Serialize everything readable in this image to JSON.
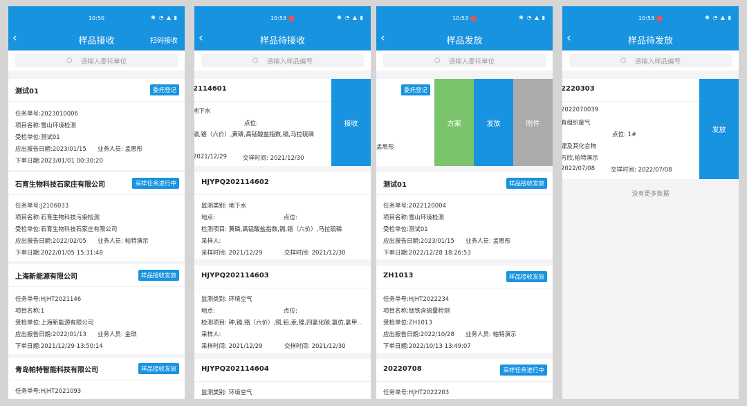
{
  "colors": {
    "primary": "#1793e0",
    "green": "#7cc46c",
    "gray": "#ababab",
    "background": "#d5d5d5"
  },
  "phones": [
    {
      "time": "10:50",
      "title": "样品接收",
      "right": "扫码接收",
      "search_placeholder": "请输入委托单位",
      "cards": [
        {
          "title": "测试01",
          "badge": "委托登记",
          "rows": [
            {
              "label": "任务单号:",
              "value": "2023010006"
            },
            {
              "label": "项目名称:",
              "value": "雪山环境检测"
            },
            {
              "label": "受检单位:",
              "value": "测试01"
            },
            {
              "label": "应出报告日期:",
              "value": "2023/01/15",
              "label2": "业务人员:",
              "value2": "孟思彤"
            },
            {
              "label": "下单日期:",
              "value": "2023/01/01 00:30:20"
            }
          ]
        },
        {
          "title": "石育生物科技石家庄有限公司",
          "badge": "采样任务进行中",
          "rows": [
            {
              "label": "任务单号:",
              "value": "J2106033"
            },
            {
              "label": "项目名称:",
              "value": "石育生物科技污染检测"
            },
            {
              "label": "受检单位:",
              "value": "石育生物科技石家庄有限公司"
            },
            {
              "label": "应出报告日期:",
              "value": "2022/02/05",
              "label2": "业务人员:",
              "value2": "帕特演示"
            },
            {
              "label": "下单日期:",
              "value": "2022/01/05 15:31:48"
            }
          ]
        },
        {
          "title": "上海新能源有限公司",
          "badge": "样品接收发放",
          "rows": [
            {
              "label": "任务单号:",
              "value": "HJHT2021146"
            },
            {
              "label": "项目名称:",
              "value": "1"
            },
            {
              "label": "受检单位:",
              "value": "上海新能源有限公司"
            },
            {
              "label": "应出报告日期:",
              "value": "2022/01/13",
              "label2": "业务人员:",
              "value2": "金琪"
            },
            {
              "label": "下单日期:",
              "value": "2021/12/29 13:50:14"
            }
          ]
        },
        {
          "title": "青岛帕特智能科技有限公司",
          "badge": "样品接收发放",
          "rows": [
            {
              "label": "任务单号:",
              "value": "HJHT2021093"
            }
          ]
        }
      ]
    },
    {
      "time": "10:53",
      "title": "样品待接收",
      "search_placeholder": "请输入样品编号",
      "swiped": {
        "title": "2114601",
        "action": "接收",
        "rows": [
          {
            "text": "地下水"
          },
          {
            "text": "点位:"
          },
          {
            "text": "镉,铬（六价）,黄磷,高锰酸盐指数,镉,马拉硫磷"
          },
          {
            "text": ""
          },
          {
            "text": "2021/12/29",
            "text2": "交样时间:",
            "value2": "2021/12/30"
          }
        ]
      },
      "cards": [
        {
          "title": "HJYPQ202114602",
          "rows": [
            {
              "label": "监测类别:",
              "value": "地下水"
            },
            {
              "label": "地点:",
              "value": "",
              "label2": "点位:",
              "value2": ""
            },
            {
              "label": "检测项目:",
              "value": "黄磷,高锰酸盐指数,镉,铬（六价）,马拉硫磷"
            },
            {
              "label": "采样人:",
              "value": ""
            },
            {
              "label": "采样时间:",
              "value": "2021/12/29",
              "label2": "交样时间:",
              "value2": "2021/12/30"
            }
          ]
        },
        {
          "title": "HJYPQ202114603",
          "rows": [
            {
              "label": "监测类别:",
              "value": "环境空气"
            },
            {
              "label": "地点:",
              "value": "",
              "label2": "点位:",
              "value2": ""
            },
            {
              "label": "检测项目:",
              "value": "砷,镉,铬（六价）,铜,铅,汞,镍,四氯化碳,氯仿,氯甲..."
            },
            {
              "label": "采样人:",
              "value": ""
            },
            {
              "label": "采样时间:",
              "value": "2021/12/29",
              "label2": "交样时间:",
              "value2": "2021/12/30"
            }
          ]
        },
        {
          "title": "HJYPQ202114604",
          "rows": [
            {
              "label": "监测类别:",
              "value": "环境空气"
            }
          ]
        }
      ]
    },
    {
      "time": "10:53",
      "title": "样品发放",
      "search_placeholder": "请输入委托单位",
      "swiped": {
        "badge": "委托登记",
        "person": "孟思彤",
        "actions": [
          "方案",
          "发放",
          "附件"
        ]
      },
      "cards": [
        {
          "title": "测试01",
          "badge": "样品接收发放",
          "rows": [
            {
              "label": "任务单号:",
              "value": "2022120004"
            },
            {
              "label": "项目名称:",
              "value": "雪山环境检测"
            },
            {
              "label": "受检单位:",
              "value": "测试01"
            },
            {
              "label": "应出报告日期:",
              "value": "2023/01/15",
              "label2": "业务人员:",
              "value2": "孟思彤"
            },
            {
              "label": "下单日期:",
              "value": "2022/12/28 18:26:53"
            }
          ]
        },
        {
          "title": "ZH1013",
          "badge": "样品接收发放",
          "rows": [
            {
              "label": "任务单号:",
              "value": "HJHT2022234"
            },
            {
              "label": "项目名称:",
              "value": "锰铁含硫量检测"
            },
            {
              "label": "受检单位:",
              "value": "ZH1013"
            },
            {
              "label": "应出报告日期:",
              "value": "2022/10/28",
              "label2": "业务人员:",
              "value2": "帕特演示"
            },
            {
              "label": "下单日期:",
              "value": "2022/10/13 13:49:07"
            }
          ]
        },
        {
          "title": "20220708",
          "badge": "采样任务进行中",
          "rows": [
            {
              "label": "任务单号:",
              "value": "HJHT2022203"
            }
          ]
        }
      ]
    },
    {
      "time": "10:53",
      "title": "样品待发放",
      "search_placeholder": "请输入样品编号",
      "swiped": {
        "title": "2220303",
        "action": "发放",
        "rows": [
          {
            "text": "2022070039"
          },
          {
            "text": "有组织废气"
          },
          {
            "text": "点位:",
            "text2": "1#"
          },
          {
            "text": "镍及其化合物"
          },
          {
            "text": "万欣,帕特演示"
          },
          {
            "text": "2022/07/08",
            "text2": "交样时间:",
            "value2": "2022/07/08"
          }
        ]
      },
      "empty": "没有更多数据"
    }
  ]
}
